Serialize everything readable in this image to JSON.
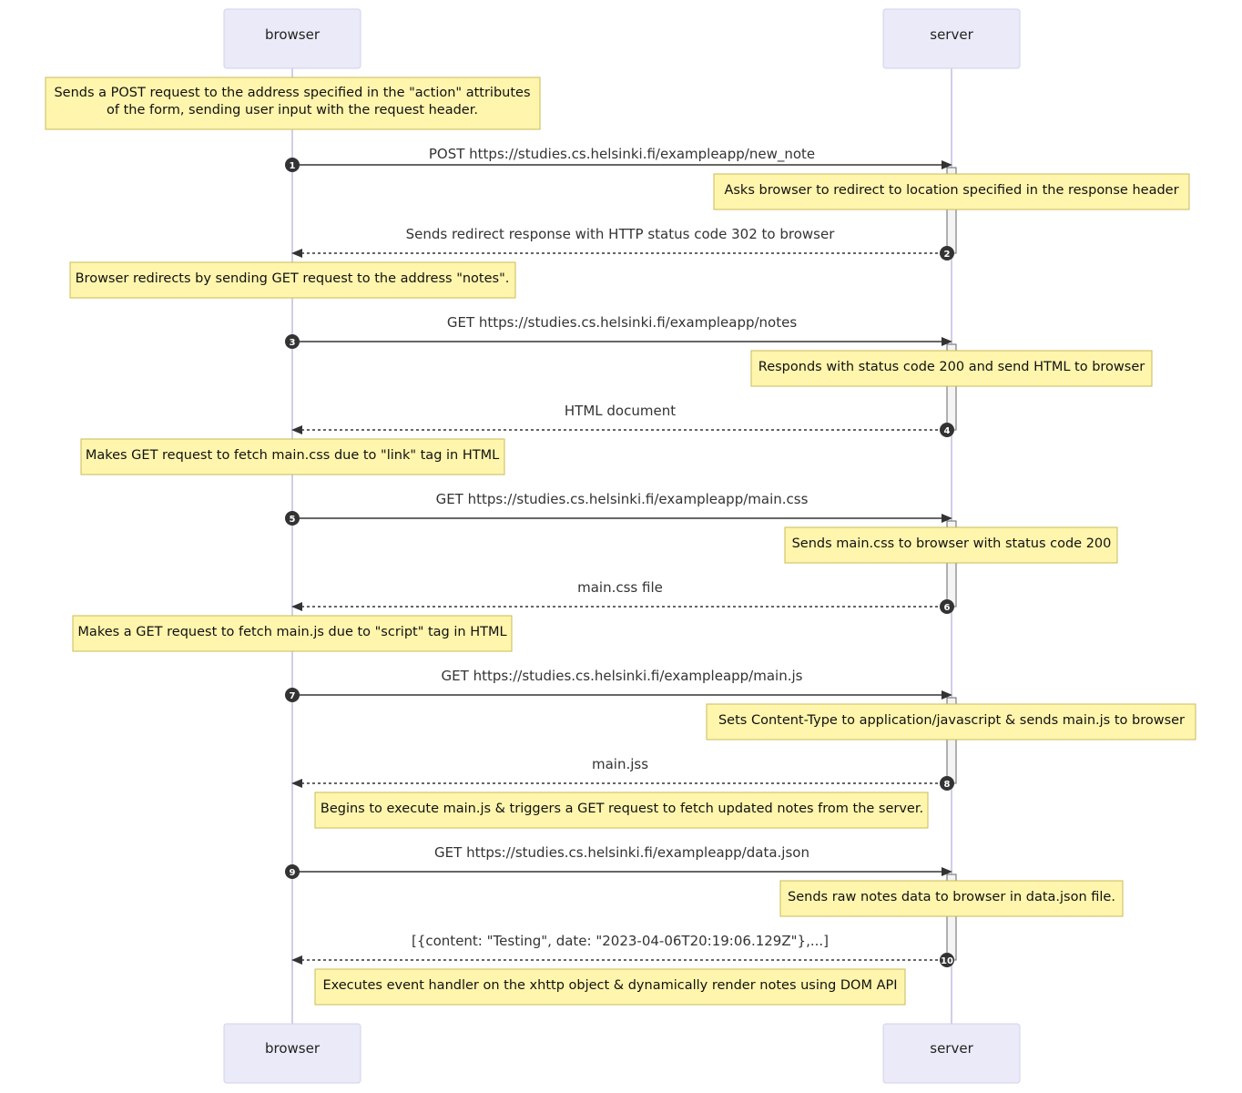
{
  "actors": {
    "browser": "browser",
    "server": "server"
  },
  "colors": {
    "actor_fill": "#eaeaf8",
    "note_fill": "#fff5ad",
    "line": "#333333"
  },
  "messages": [
    {
      "seq": "1",
      "label": "POST https://studies.cs.helsinki.fi/exampleapp/new_note"
    },
    {
      "seq": "2",
      "label": "Sends redirect response with HTTP status code 302 to browser"
    },
    {
      "seq": "3",
      "label": "GET https://studies.cs.helsinki.fi/exampleapp/notes"
    },
    {
      "seq": "4",
      "label": "HTML document"
    },
    {
      "seq": "5",
      "label": "GET https://studies.cs.helsinki.fi/exampleapp/main.css"
    },
    {
      "seq": "6",
      "label": "main.css file"
    },
    {
      "seq": "7",
      "label": "GET https://studies.cs.helsinki.fi/exampleapp/main.js"
    },
    {
      "seq": "8",
      "label": "main.jss"
    },
    {
      "seq": "9",
      "label": "GET https://studies.cs.helsinki.fi/exampleapp/data.json"
    },
    {
      "seq": "10",
      "label": "[{content: \"Testing\", date: \"2023-04-06T20:19:06.129Z\"},...]"
    }
  ],
  "notes": [
    {
      "lines": [
        "Sends a POST request to the address specified in the \"action\" attributes",
        "of the form, sending user input with the request header."
      ]
    },
    {
      "lines": [
        "Asks browser to redirect to location specified in the response header"
      ]
    },
    {
      "lines": [
        "Browser redirects by sending GET request to the address \"notes\"."
      ]
    },
    {
      "lines": [
        "Responds with status code 200 and send HTML to browser"
      ]
    },
    {
      "lines": [
        "Makes GET request to fetch main.css due to \"link\" tag in HTML"
      ]
    },
    {
      "lines": [
        "Sends main.css to browser with status code 200"
      ]
    },
    {
      "lines": [
        "Makes a GET request to fetch main.js due to \"script\" tag in HTML"
      ]
    },
    {
      "lines": [
        "Sets Content-Type to application/javascript & sends main.js to browser"
      ]
    },
    {
      "lines": [
        "Begins to execute main.js & triggers a GET request to fetch updated notes from the server."
      ]
    },
    {
      "lines": [
        "Sends raw notes data to browser in data.json file."
      ]
    },
    {
      "lines": [
        "Executes event handler on the xhttp object & dynamically render notes using DOM API"
      ]
    }
  ]
}
